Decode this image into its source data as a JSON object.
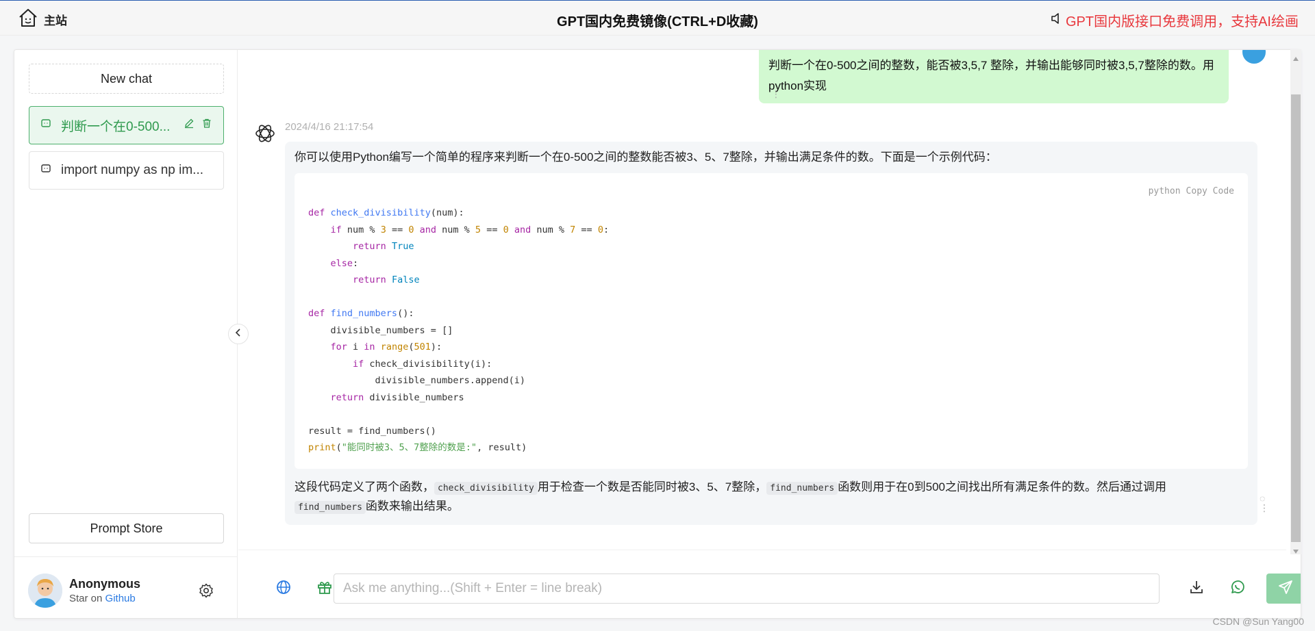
{
  "topbar": {
    "home_label": "主站",
    "site_title": "GPT国内免费镜像(CTRL+D收藏)",
    "notice": "GPT国内版接口免费调用，支持AI绘画"
  },
  "sidebar": {
    "new_chat": "New chat",
    "history": [
      {
        "title": "判断一个在0-500..."
      },
      {
        "title": "import numpy as np im..."
      }
    ],
    "prompt_store": "Prompt Store",
    "user": {
      "name": "Anonymous",
      "star_prefix": "Star on",
      "github": "Github"
    }
  },
  "chat": {
    "user_message": "判断一个在0-500之间的整数，能否被3,5,7 整除，并输出能够同时被3,5,7整除的数。用python实现",
    "bot_timestamp": "2024/4/16 21:17:54",
    "bot_intro": "你可以使用Python编写一个简单的程序来判断一个在0-500之间的整数能否被3、5、7整除，并输出满足条件的数。下面是一个示例代码：",
    "code": {
      "language": "python",
      "copy_label": "Copy Code"
    },
    "explain": {
      "p1": "这段代码定义了两个函数，",
      "c1": "check_divisibility",
      "p2": "用于检查一个数是否能同时被3、5、7整除，",
      "c2": "find_numbers",
      "p3": "函数则用于在0到500之间找出所有满足条件的数。然后通过调用",
      "c3": "find_numbers",
      "p4": "函数来输出结果。"
    }
  },
  "input": {
    "placeholder": "Ask me anything...(Shift + Enter = line break)"
  },
  "watermark": "CSDN @Sun Yang00",
  "colors": {
    "accent_green": "#4caf6c",
    "notice_red": "#e8383d",
    "user_bubble": "#d2f9d1",
    "link_blue": "#2a7ae2"
  }
}
